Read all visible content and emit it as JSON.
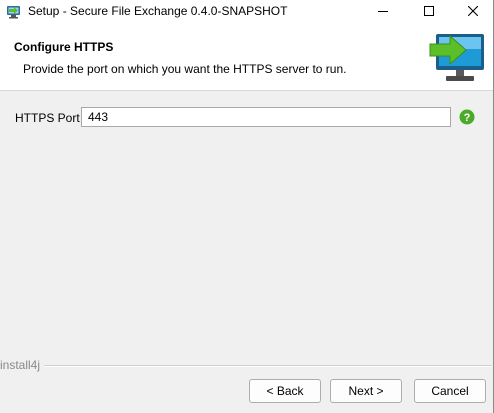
{
  "window": {
    "title": "Setup - Secure File Exchange 0.4.0-SNAPSHOT",
    "controls": {
      "minimize_icon": "minimize-icon",
      "maximize_icon": "maximize-icon",
      "close_icon": "close-icon"
    }
  },
  "header": {
    "title": "Configure HTTPS",
    "subtitle": "Provide the port on which you want the HTTPS server to run.",
    "graphic": "monitor-with-green-arrow-icon"
  },
  "form": {
    "port_label": "HTTPS Port",
    "port_value": "443",
    "help_icon": "help-icon"
  },
  "footer": {
    "brand": "install4j",
    "back_label": "< Back",
    "next_label": "Next >",
    "cancel_label": "Cancel"
  },
  "colors": {
    "help_green": "#4caa2a",
    "arrow_green": "#5cbf2a",
    "monitor_blue": "#1e9bd7",
    "brand_gray": "#8a8a8a"
  }
}
